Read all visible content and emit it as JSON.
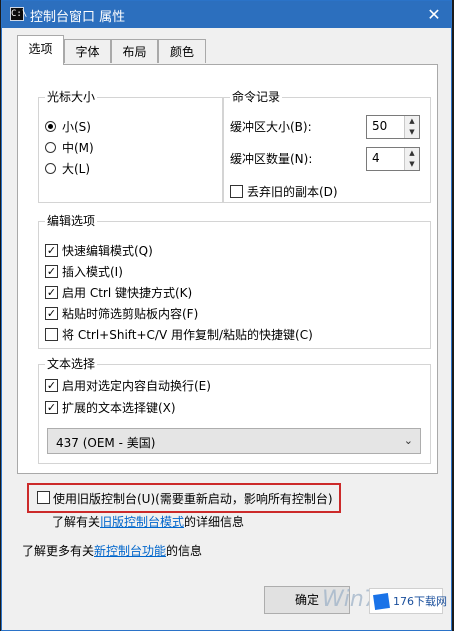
{
  "window": {
    "title": "控制台窗口 属性",
    "close_glyph": "✕",
    "icon_glyph": "C:\\"
  },
  "tabs": [
    {
      "label": "选项"
    },
    {
      "label": "字体"
    },
    {
      "label": "布局"
    },
    {
      "label": "颜色"
    }
  ],
  "cursor_size": {
    "title": "光标大小",
    "options": [
      {
        "label": "小(S)",
        "checked": true
      },
      {
        "label": "中(M)",
        "checked": false
      },
      {
        "label": "大(L)",
        "checked": false
      }
    ]
  },
  "command_history": {
    "title": "命令记录",
    "buffer_size_label": "缓冲区大小(B):",
    "buffer_size_value": "50",
    "buffer_count_label": "缓冲区数量(N):",
    "buffer_count_value": "4",
    "discard_old_label": "丢弃旧的副本(D)",
    "discard_old_checked": false
  },
  "edit_options": {
    "title": "编辑选项",
    "items": [
      {
        "label": "快速编辑模式(Q)",
        "checked": true
      },
      {
        "label": "插入模式(I)",
        "checked": true
      },
      {
        "label": "启用 Ctrl 键快捷方式(K)",
        "checked": true
      },
      {
        "label": "粘贴时筛选剪贴板内容(F)",
        "checked": true
      },
      {
        "label": "将 Ctrl+Shift+C/V 用作复制/粘贴的快捷键(C)",
        "checked": false
      }
    ]
  },
  "text_selection": {
    "title": "文本选择",
    "items": [
      {
        "label": "启用对选定内容自动换行(E)",
        "checked": true
      },
      {
        "label": "扩展的文本选择键(X)",
        "checked": true
      }
    ]
  },
  "codepage": {
    "value": "437   (OEM - 美国)"
  },
  "legacy": {
    "label": "使用旧版控制台(U)(需要重新启动，影响所有控制台)",
    "checked": false
  },
  "info1": {
    "prefix": "了解有关",
    "link": "旧版控制台模式",
    "suffix": "的详细信息"
  },
  "info2": {
    "prefix": "了解更多有关",
    "link": "新控制台功能",
    "suffix": "的信息"
  },
  "buttons": {
    "ok_label": "确定"
  },
  "watermark": {
    "text": "Win7"
  },
  "brand": {
    "text": "176下载网"
  },
  "icons": {
    "check": "✓",
    "spin_up": "▲",
    "spin_down": "▼",
    "dropdown": "⌄"
  },
  "colors": {
    "titlebar": "#2c6fbe",
    "link": "#0066cc",
    "highlight_border": "#cc2a2a"
  }
}
